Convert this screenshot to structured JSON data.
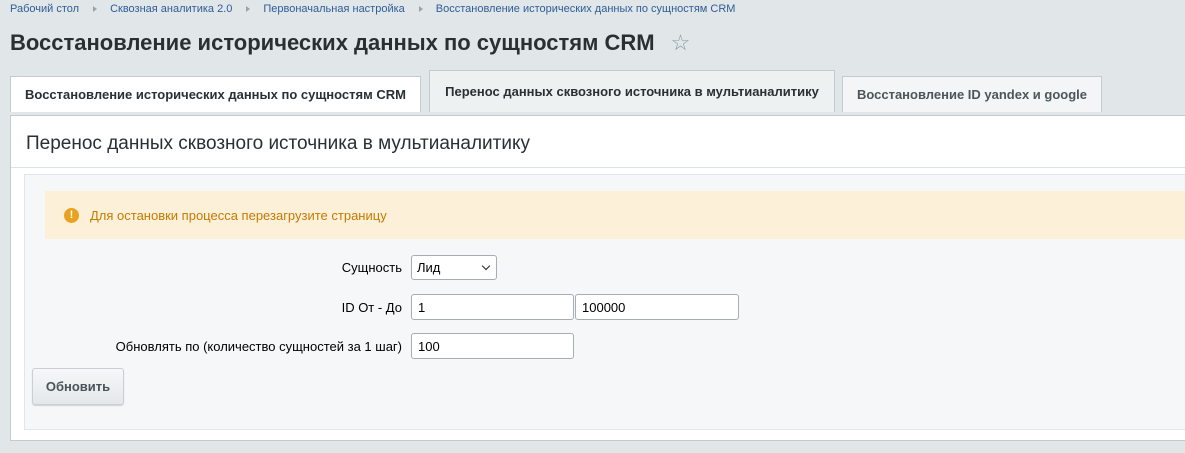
{
  "breadcrumb": {
    "items": [
      "Рабочий стол",
      "Сквозная аналитика 2.0",
      "Первоначальная настройка",
      "Восстановление исторических данных по сущностям CRM"
    ]
  },
  "page": {
    "title": "Восстановление исторических данных по сущностям CRM",
    "star_icon": "☆"
  },
  "tabs": [
    {
      "label": "Восстановление исторических данных по сущностям CRM",
      "active": false
    },
    {
      "label": "Перенос данных сквозного источника в мультианалитику",
      "active": true
    },
    {
      "label": "Восстановление ID yandex и google",
      "active": false
    }
  ],
  "panel": {
    "title": "Перенос данных сквозного источника в мультианалитику"
  },
  "alert": {
    "icon": "!",
    "text": "Для остановки процесса перезагрузите страницу",
    "color": "#c57a00",
    "background": "#fdf0d9"
  },
  "form": {
    "entity": {
      "label": "Сущность",
      "value": "Лид"
    },
    "id_range": {
      "label": "ID От - До",
      "from": "1",
      "to": "100000"
    },
    "step": {
      "label": "Обновлять по (количество сущностей за 1 шаг)",
      "value": "100"
    },
    "submit_label": "Обновить"
  }
}
